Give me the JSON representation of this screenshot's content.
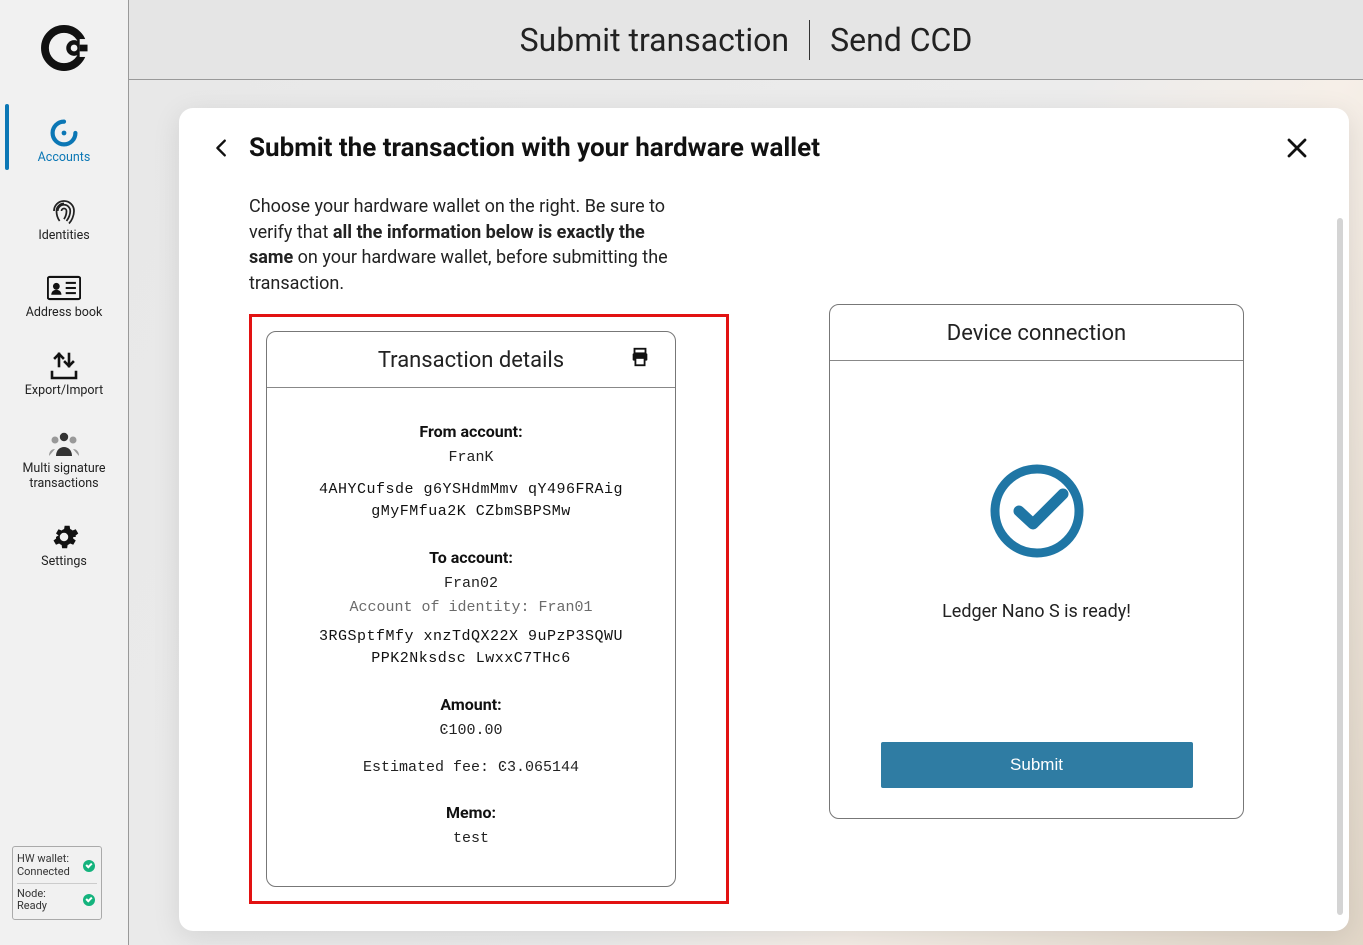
{
  "sidebar": {
    "items": [
      {
        "label": "Accounts"
      },
      {
        "label": "Identities"
      },
      {
        "label": "Address book"
      },
      {
        "label": "Export/Import"
      },
      {
        "label_line1": "Multi signature",
        "label_line2": "transactions"
      },
      {
        "label": "Settings"
      }
    ],
    "status": {
      "hw_label_line1": "HW wallet:",
      "hw_label_line2": "Connected",
      "node_label_line1": "Node:",
      "node_label_line2": "Ready"
    }
  },
  "topbar": {
    "title": "Submit transaction",
    "subtitle": "Send CCD"
  },
  "modal": {
    "title": "Submit the transaction with your hardware wallet",
    "intro_pre": "Choose your hardware wallet on the right. Be sure to verify that ",
    "intro_bold": "all the information below is exactly the same",
    "intro_post": " on your hardware wallet, before submitting the transaction.",
    "details": {
      "heading": "Transaction details",
      "from_label": "From account:",
      "from_name": "FranK",
      "from_addr_l1": "4AHYCufsde g6YSHdmMmv qY496FRAig",
      "from_addr_l2": "gMyFMfua2K CZbmSBPSMw",
      "to_label": "To account:",
      "to_name": "Fran02",
      "to_identity": "Account of identity: Fran01",
      "to_addr_l1": "3RGSptfMfy xnzTdQX22X 9uPzP3SQWU",
      "to_addr_l2": "PPK2Nksdsc LwxxC7THc6",
      "amount_label": "Amount:",
      "amount_value": "Ͼ100.00",
      "fee": "Estimated fee: Ͼ3.065144",
      "memo_label": "Memo:",
      "memo_value": "test"
    },
    "device": {
      "heading": "Device connection",
      "ready_msg": "Ledger Nano S is ready!",
      "submit_label": "Submit"
    }
  }
}
